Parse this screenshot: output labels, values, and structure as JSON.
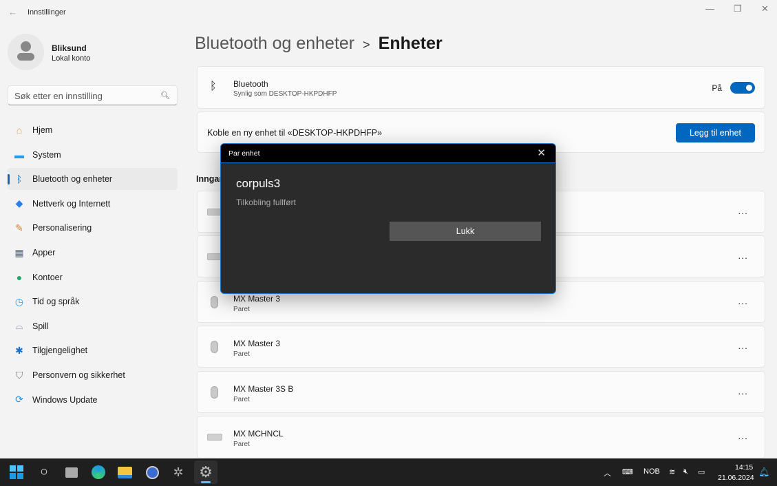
{
  "window": {
    "title": "Innstillinger",
    "back_icon": "arrow-left-icon",
    "controls": [
      "minimize-icon",
      "restore-icon",
      "close-icon"
    ]
  },
  "user": {
    "name": "Bliksund",
    "account": "Lokal konto"
  },
  "search": {
    "placeholder": "Søk etter en innstilling"
  },
  "sidebar": {
    "items": [
      {
        "label": "Hjem",
        "icon": "home-icon"
      },
      {
        "label": "System",
        "icon": "monitor-icon"
      },
      {
        "label": "Bluetooth og enheter",
        "icon": "bluetooth-icon",
        "selected": true
      },
      {
        "label": "Nettverk og Internett",
        "icon": "wifi-icon"
      },
      {
        "label": "Personalisering",
        "icon": "brush-icon"
      },
      {
        "label": "Apper",
        "icon": "apps-icon"
      },
      {
        "label": "Kontoer",
        "icon": "person-icon"
      },
      {
        "label": "Tid og språk",
        "icon": "clock-globe-icon"
      },
      {
        "label": "Spill",
        "icon": "gamepad-icon"
      },
      {
        "label": "Tilgjengelighet",
        "icon": "accessibility-icon"
      },
      {
        "label": "Personvern og sikkerhet",
        "icon": "shield-icon"
      },
      {
        "label": "Windows Update",
        "icon": "update-icon"
      }
    ]
  },
  "header": {
    "parent": "Bluetooth og enheter",
    "separator": ">",
    "current": "Enheter"
  },
  "bluetooth": {
    "title": "Bluetooth",
    "subtitle": "Synlig som DESKTOP-HKPDHFP",
    "state": "På",
    "enabled": true
  },
  "add_device": {
    "label": "Koble en ny enhet til «DESKTOP-HKPDHFP»",
    "button": "Legg til enhet"
  },
  "section_title": "Inngang",
  "devices": [
    {
      "name": "",
      "status": "",
      "icon": "keyboard-icon"
    },
    {
      "name": "",
      "status": "",
      "icon": "keyboard-icon"
    },
    {
      "name": "MX Master 3",
      "status": "Paret",
      "icon": "mouse-icon"
    },
    {
      "name": "MX Master 3",
      "status": "Paret",
      "icon": "mouse-icon"
    },
    {
      "name": "MX Master 3S B",
      "status": "Paret",
      "icon": "mouse-icon"
    },
    {
      "name": "MX MCHNCL",
      "status": "Paret",
      "icon": "keyboard-icon"
    }
  ],
  "more_label": "...",
  "dialog": {
    "title": "Par enhet",
    "device": "corpuls3",
    "message": "Tilkobling fullført",
    "button": "Lukk"
  },
  "taskbar": {
    "apps": [
      "start-icon",
      "search-icon",
      "task-view-icon",
      "edge-icon",
      "file-explorer-icon",
      "app-icon",
      "app-icon",
      "settings-icon"
    ],
    "language": "NOB",
    "time": "14:15",
    "date": "21.06.2024"
  },
  "colors": {
    "accent": "#0067c0",
    "dialog_bg": "#2b2b2b",
    "taskbar": "#1f1f1f"
  }
}
